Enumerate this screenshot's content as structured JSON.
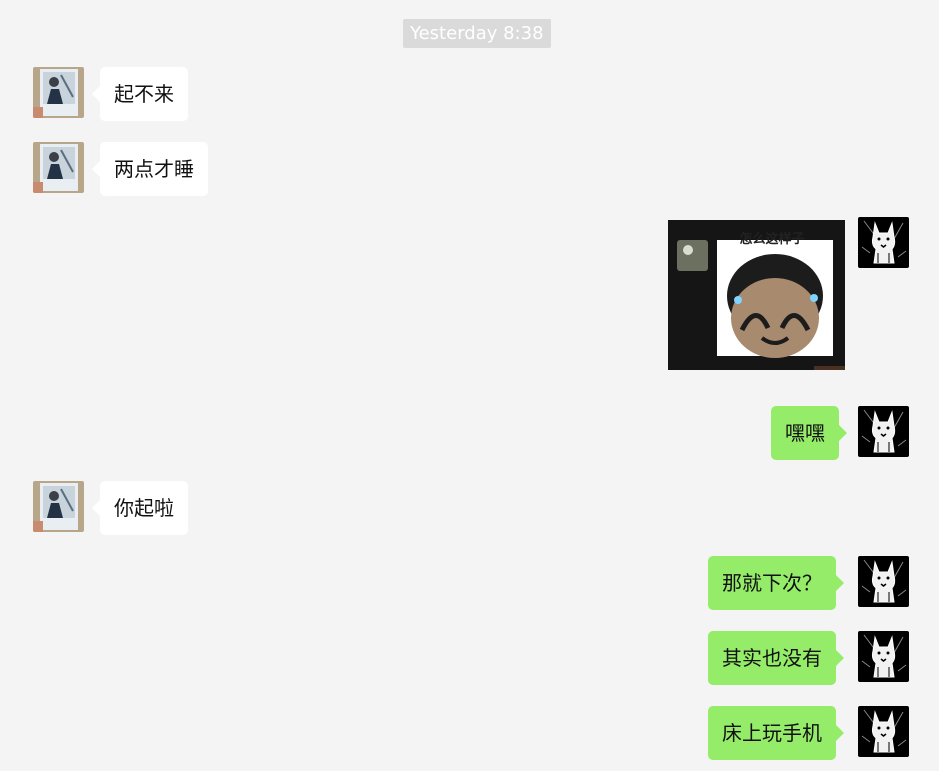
{
  "timestamp": "Yesterday 8:38",
  "messages": [
    {
      "side": "left",
      "text": "起不来"
    },
    {
      "side": "left",
      "text": "两点才睡"
    },
    {
      "side": "right",
      "type": "sticker",
      "sticker_caption": "怎么这样子"
    },
    {
      "side": "right",
      "text": "嘿嘿"
    },
    {
      "side": "left",
      "text": "你起啦"
    },
    {
      "side": "right",
      "text": "那就下次？"
    },
    {
      "side": "right",
      "text": "其实也没有"
    },
    {
      "side": "right",
      "text": "床上玩手机"
    }
  ],
  "avatars": {
    "contact": "photo-person-avatar",
    "self": "dog-sketch-avatar"
  },
  "colors": {
    "background": "#f4f4f4",
    "incoming_bubble": "#ffffff",
    "outgoing_bubble": "#95ec69",
    "timestamp_bg": "#dadada"
  }
}
